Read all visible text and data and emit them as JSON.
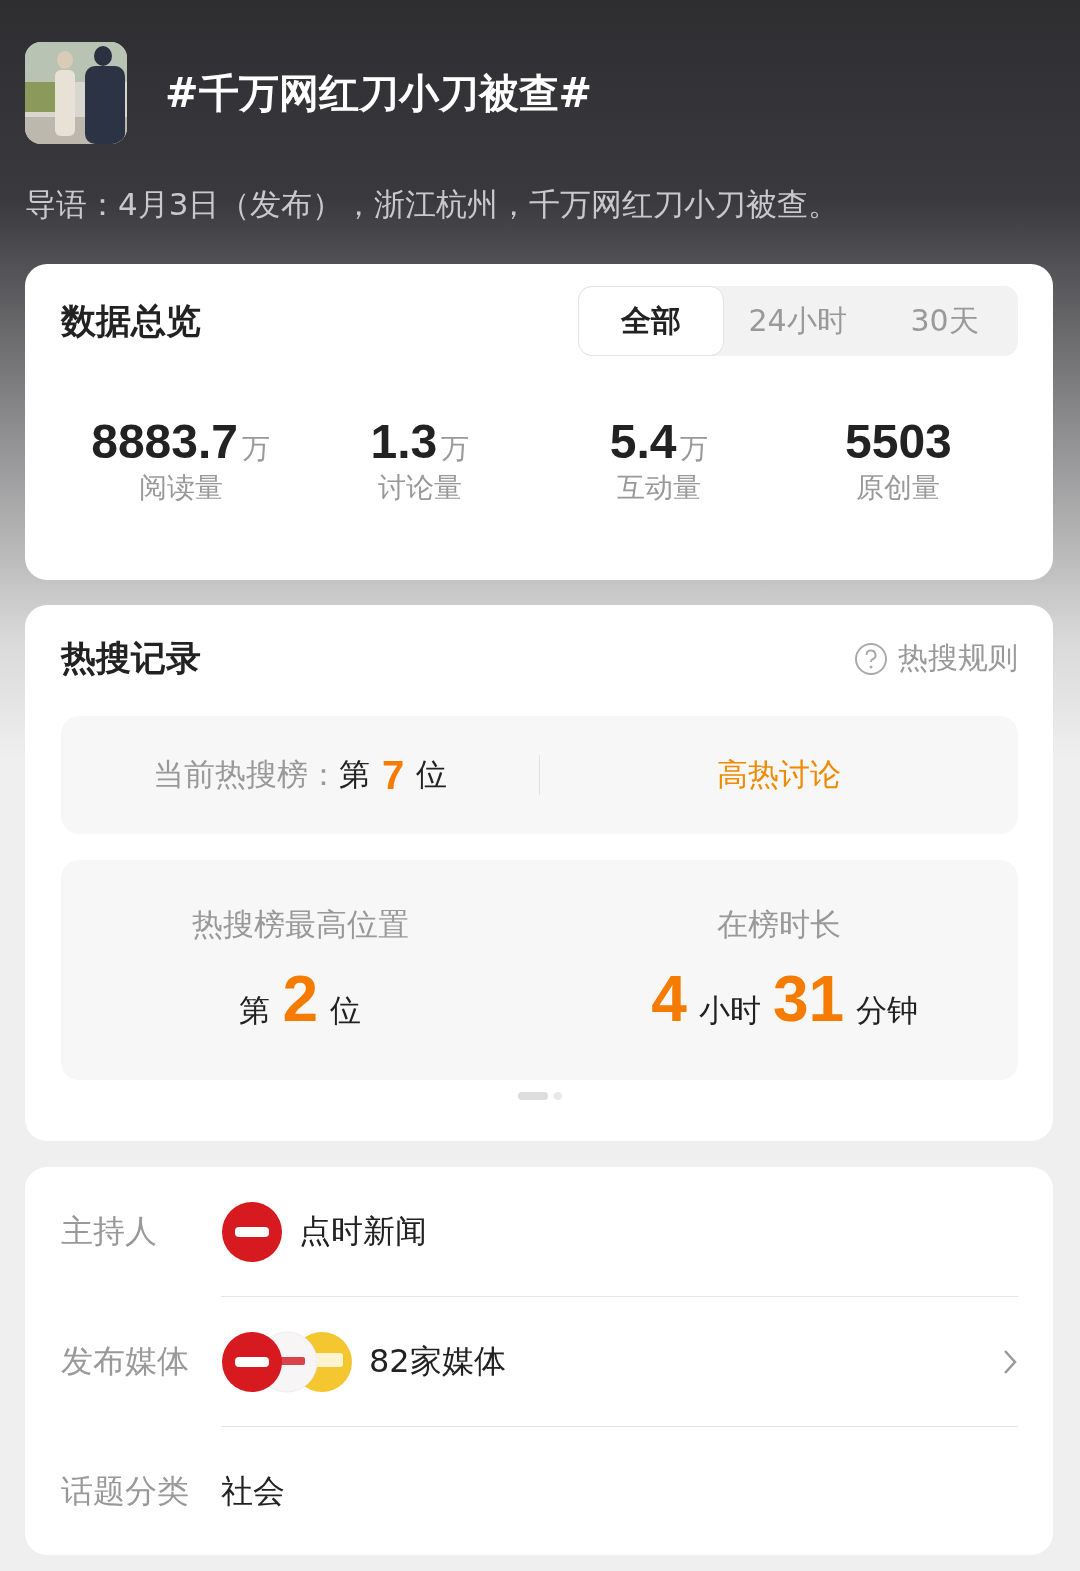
{
  "topic": {
    "title": "#千万网红刀小刀被查#",
    "lead": "导语：4月3日（发布），浙江杭州，千万网红刀小刀被查。"
  },
  "overview": {
    "title": "数据总览",
    "tabs": [
      {
        "label": "全部",
        "selected": true
      },
      {
        "label": "24小时",
        "selected": false
      },
      {
        "label": "30天",
        "selected": false
      }
    ],
    "stats": [
      {
        "value": "8883.7",
        "unit": "万",
        "label": "阅读量"
      },
      {
        "value": "1.3",
        "unit": "万",
        "label": "讨论量"
      },
      {
        "value": "5.4",
        "unit": "万",
        "label": "互动量"
      },
      {
        "value": "5503",
        "label": "原创量"
      }
    ]
  },
  "hot_search": {
    "title": "热搜记录",
    "rules_link": "热搜规则",
    "current": {
      "label": "当前热搜榜：",
      "prefix": "第",
      "number": "7",
      "suffix": "位",
      "status": "高热讨论"
    },
    "peak": {
      "label": "热搜榜最高位置",
      "parts": [
        {
          "kind": "unit",
          "text": "第"
        },
        {
          "kind": "number",
          "text": "2"
        },
        {
          "kind": "unit",
          "text": "位"
        }
      ]
    },
    "duration": {
      "label": "在榜时长",
      "parts": [
        {
          "kind": "number",
          "text": "4"
        },
        {
          "kind": "unit",
          "text": "小时"
        },
        {
          "kind": "number",
          "text": "31"
        },
        {
          "kind": "unit",
          "text": "分钟"
        }
      ]
    },
    "pages": [
      {
        "selected": true
      },
      {
        "selected": false
      }
    ]
  },
  "info": [
    {
      "kind": "host",
      "label": "主持人",
      "value": "点时新闻"
    },
    {
      "kind": "media",
      "label": "发布媒体",
      "value": "82家媒体"
    },
    {
      "kind": "plain",
      "label": "话题分类",
      "value": "社会"
    }
  ]
}
